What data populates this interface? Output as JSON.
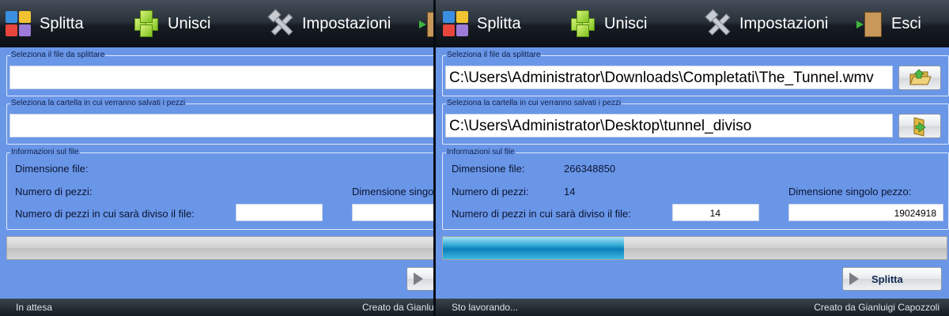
{
  "toolbar": {
    "splitta": "Splitta",
    "unisci": "Unisci",
    "impostazioni": "Impostazioni",
    "esci": "Esci"
  },
  "file_group": {
    "title": "Seleziona il file da splittare"
  },
  "folder_group": {
    "title": "Seleziona la cartella in cui verranno salvati i pezzi"
  },
  "info_group": {
    "title": "Informazioni sul file",
    "size_label": "Dimensione file:",
    "pieces_label": "Numero di pezzi:",
    "piece_size_label": "Dimensione singolo pezzo:",
    "divide_label": "Numero di pezzi in cui sarà diviso il file:"
  },
  "left": {
    "file_path": "",
    "folder_path": "",
    "file_size": "",
    "pieces": "",
    "divide_count": "",
    "piece_size": "",
    "progress": 0,
    "status": "In attesa",
    "credit": "Creato da Gianluigi Capozzoli"
  },
  "right": {
    "file_path": "C:\\Users\\Administrator\\Downloads\\Completati\\The_Tunnel.wmv",
    "folder_path": "C:\\Users\\Administrator\\Desktop\\tunnel_diviso",
    "file_size": "266348850",
    "pieces": "14",
    "divide_count": "14",
    "piece_size": "19024918",
    "progress": 0.36,
    "action_label": "Splitta",
    "status": "Sto lavorando...",
    "credit": "Creato da Gianluigi Capozzoli"
  }
}
